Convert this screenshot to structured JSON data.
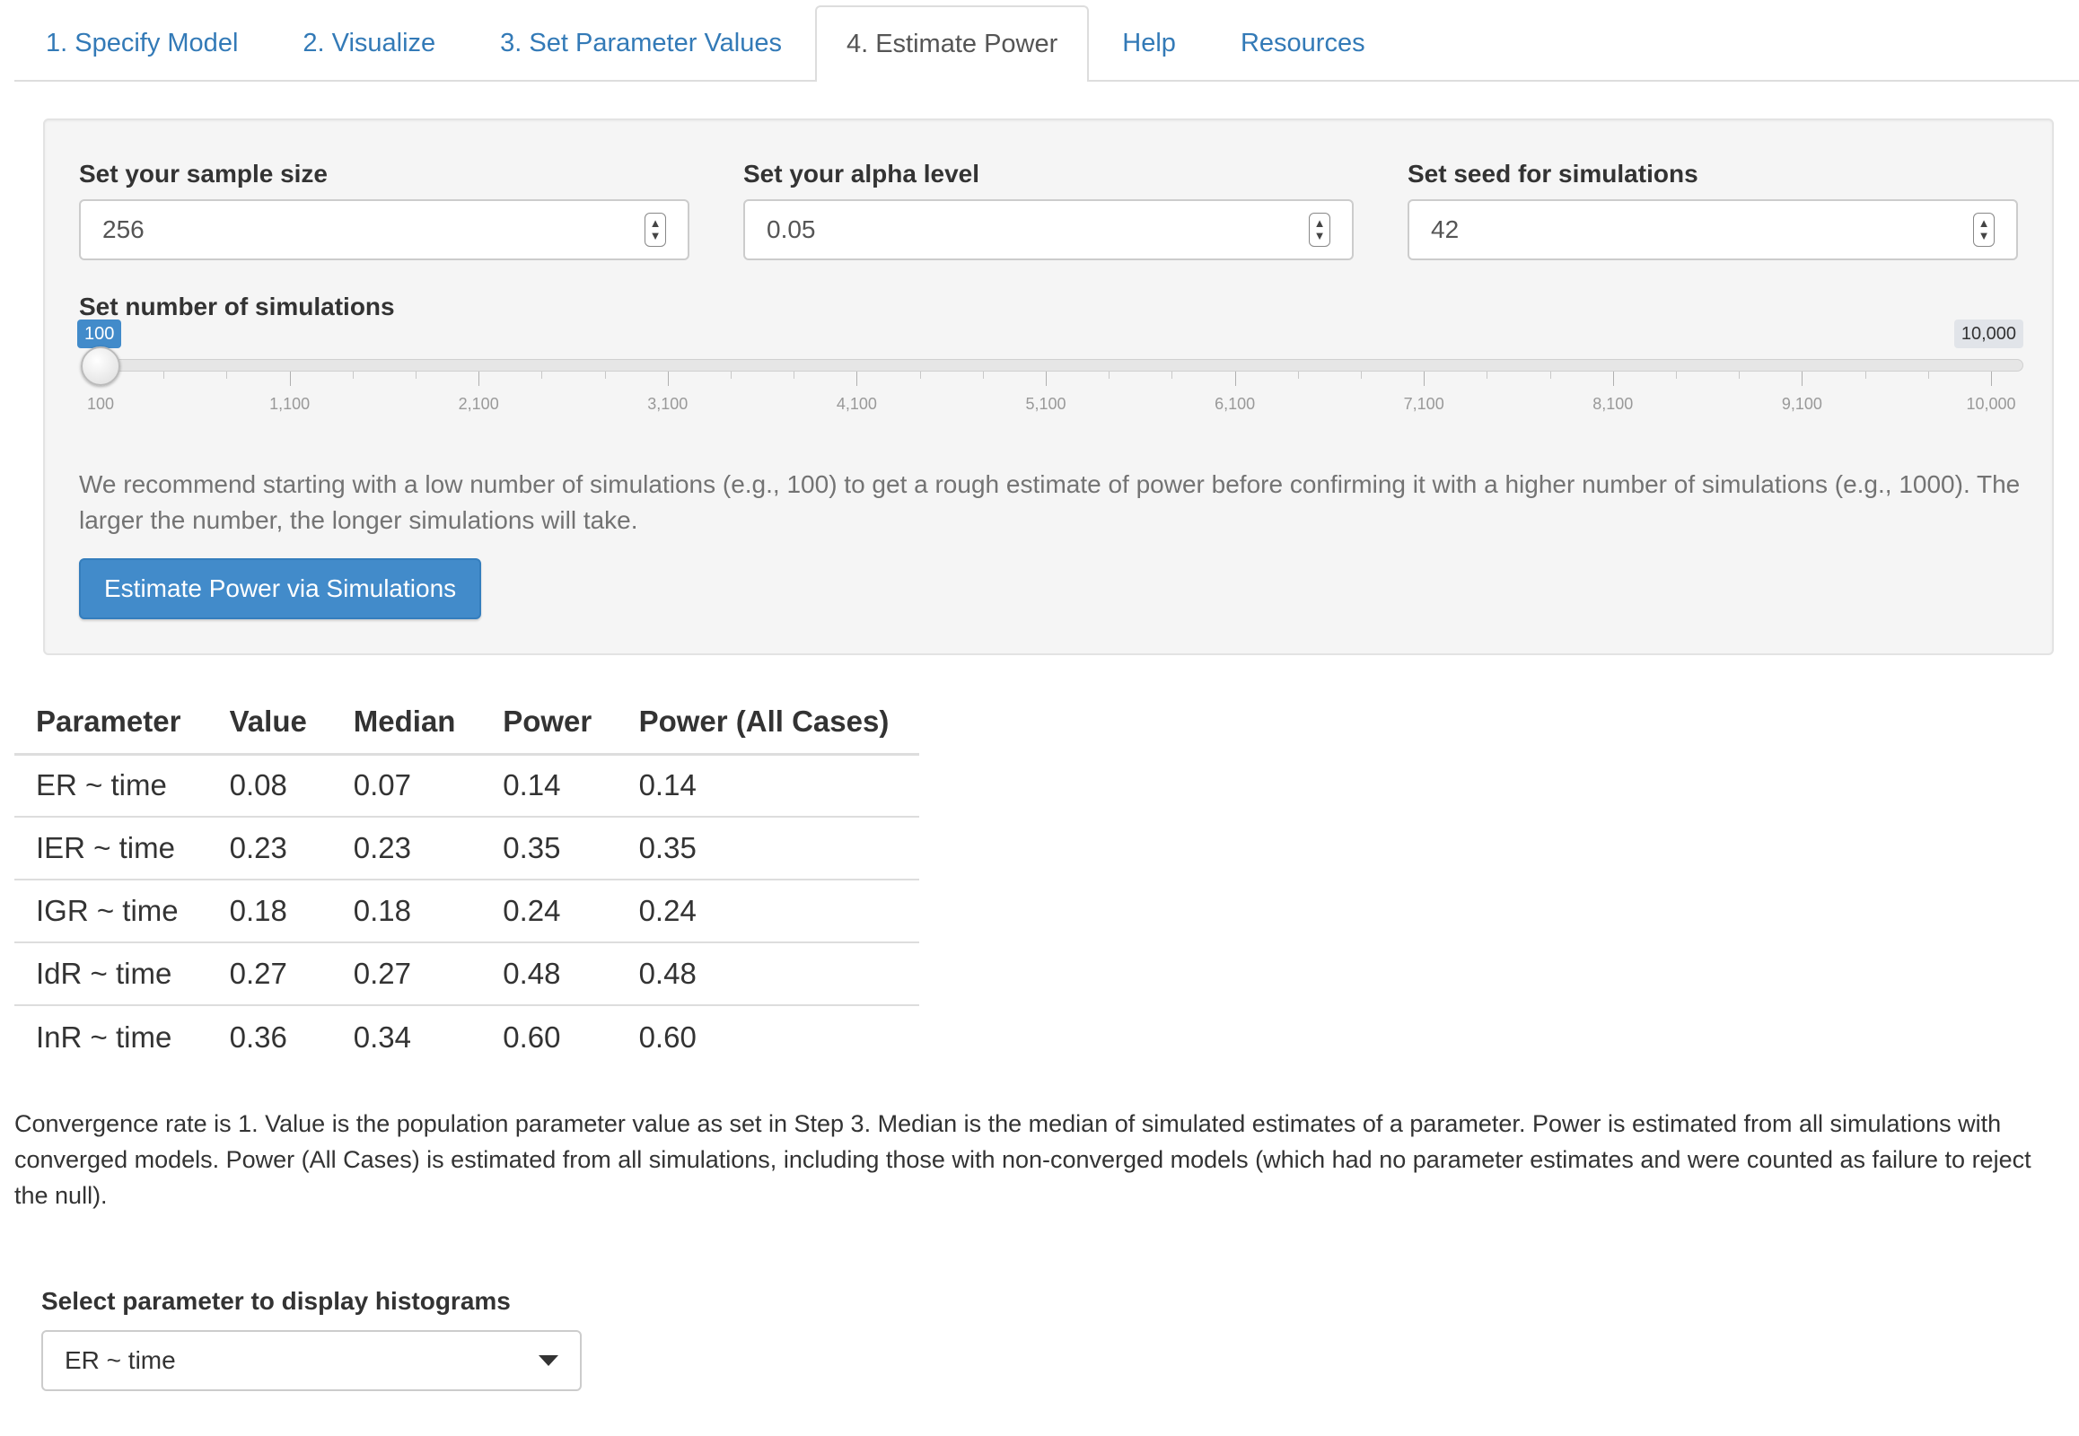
{
  "tabs": [
    {
      "label": "1. Specify Model",
      "active": false
    },
    {
      "label": "2. Visualize",
      "active": false
    },
    {
      "label": "3. Set Parameter Values",
      "active": false
    },
    {
      "label": "4. Estimate Power",
      "active": true
    },
    {
      "label": "Help",
      "active": false
    },
    {
      "label": "Resources",
      "active": false
    }
  ],
  "inputs": {
    "sample_size": {
      "label": "Set your sample size",
      "value": "256"
    },
    "alpha": {
      "label": "Set your alpha level",
      "value": "0.05"
    },
    "seed": {
      "label": "Set seed for simulations",
      "value": "42"
    }
  },
  "slider": {
    "label": "Set number of simulations",
    "current": "100",
    "min_label": "100",
    "max_label": "10,000",
    "value": 100,
    "min": 100,
    "max": 10000,
    "ticks": [
      "100",
      "1,100",
      "2,100",
      "3,100",
      "4,100",
      "5,100",
      "6,100",
      "7,100",
      "8,100",
      "9,100",
      "10,000"
    ]
  },
  "help_text": "We recommend starting with a low number of simulations (e.g., 100) to get a rough estimate of power before confirming it with a higher number of simulations (e.g., 1000). The larger the number, the longer simulations will take.",
  "run_button": "Estimate Power via Simulations",
  "table": {
    "headers": [
      "Parameter",
      "Value",
      "Median",
      "Power",
      "Power (All Cases)"
    ],
    "rows": [
      [
        "ER ~ time",
        "0.08",
        "0.07",
        "0.14",
        "0.14"
      ],
      [
        "IER ~ time",
        "0.23",
        "0.23",
        "0.35",
        "0.35"
      ],
      [
        "IGR ~ time",
        "0.18",
        "0.18",
        "0.24",
        "0.24"
      ],
      [
        "IdR ~ time",
        "0.27",
        "0.27",
        "0.48",
        "0.48"
      ],
      [
        "InR ~ time",
        "0.36",
        "0.34",
        "0.60",
        "0.60"
      ]
    ]
  },
  "note": "Convergence rate is 1. Value is the population parameter value as set in Step 3. Median is the median of simulated estimates of a parameter. Power is estimated from all simulations with converged models. Power (All Cases) is estimated from all simulations, including those with non-converged models (which had no parameter estimates and were counted as failure to reject the null).",
  "histogram_select": {
    "label": "Select parameter to display histograms",
    "value": "ER ~ time"
  },
  "colors": {
    "link": "#337ab7",
    "primary": "#428bca",
    "well_bg": "#f5f5f5",
    "badge_max": "#e1e4e9"
  }
}
